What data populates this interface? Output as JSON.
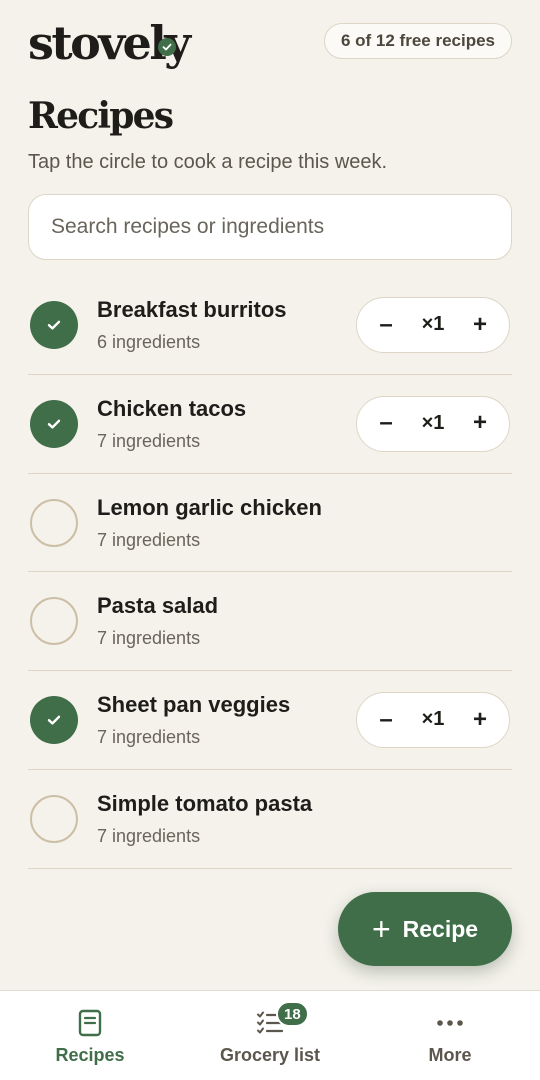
{
  "brand": {
    "name": "stovely",
    "accent": "#3f6e49"
  },
  "header": {
    "free_badge": "6 of 12 free recipes"
  },
  "page": {
    "title": "Recipes",
    "subtitle": "Tap the circle to cook a recipe this week."
  },
  "search": {
    "placeholder": "Search recipes or ingredients",
    "value": ""
  },
  "recipes": [
    {
      "name": "Breakfast burritos",
      "ingredients": "6 ingredients",
      "cooking": true,
      "servings": "×1"
    },
    {
      "name": "Chicken tacos",
      "ingredients": "7 ingredients",
      "cooking": true,
      "servings": "×1"
    },
    {
      "name": "Lemon garlic chicken",
      "ingredients": "7 ingredients",
      "cooking": false
    },
    {
      "name": "Pasta salad",
      "ingredients": "7 ingredients",
      "cooking": false
    },
    {
      "name": "Sheet pan veggies",
      "ingredients": "7 ingredients",
      "cooking": true,
      "servings": "×1"
    },
    {
      "name": "Simple tomato pasta",
      "ingredients": "7 ingredients",
      "cooking": false
    }
  ],
  "stepper": {
    "minus": "–",
    "plus": "+"
  },
  "fab": {
    "plus": "+",
    "label": "Recipe"
  },
  "nav": {
    "items": [
      {
        "label": "Recipes",
        "icon": "book-icon",
        "active": true
      },
      {
        "label": "Grocery list",
        "icon": "list-icon",
        "badge": "18"
      },
      {
        "label": "More",
        "icon": "more-icon"
      }
    ]
  }
}
